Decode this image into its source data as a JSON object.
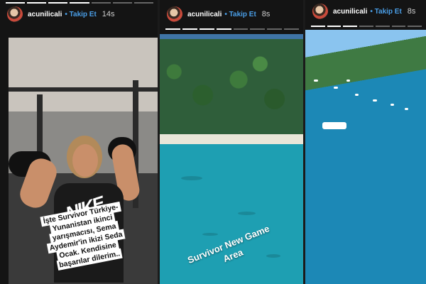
{
  "stories": [
    {
      "username": "acunilicali",
      "follow_label": "• Takip Et",
      "time": "14s",
      "caption": "İşte Survivor Türkiye-Yunanistan ikinci yarışmacısı, Sema Aydemir'in ikizi Seda Ocak. Kendisine başarılar dilerim..",
      "shirt_text": "NIKE"
    },
    {
      "username": "acunilicali",
      "follow_label": "• Takip Et",
      "time": "8s",
      "caption": "Survivor New Game Area"
    },
    {
      "username": "acunilicali",
      "follow_label": "• Takip Et",
      "time": "8s"
    }
  ],
  "colors": {
    "follow": "#4a9fe8",
    "water": "#1e9fb2"
  }
}
